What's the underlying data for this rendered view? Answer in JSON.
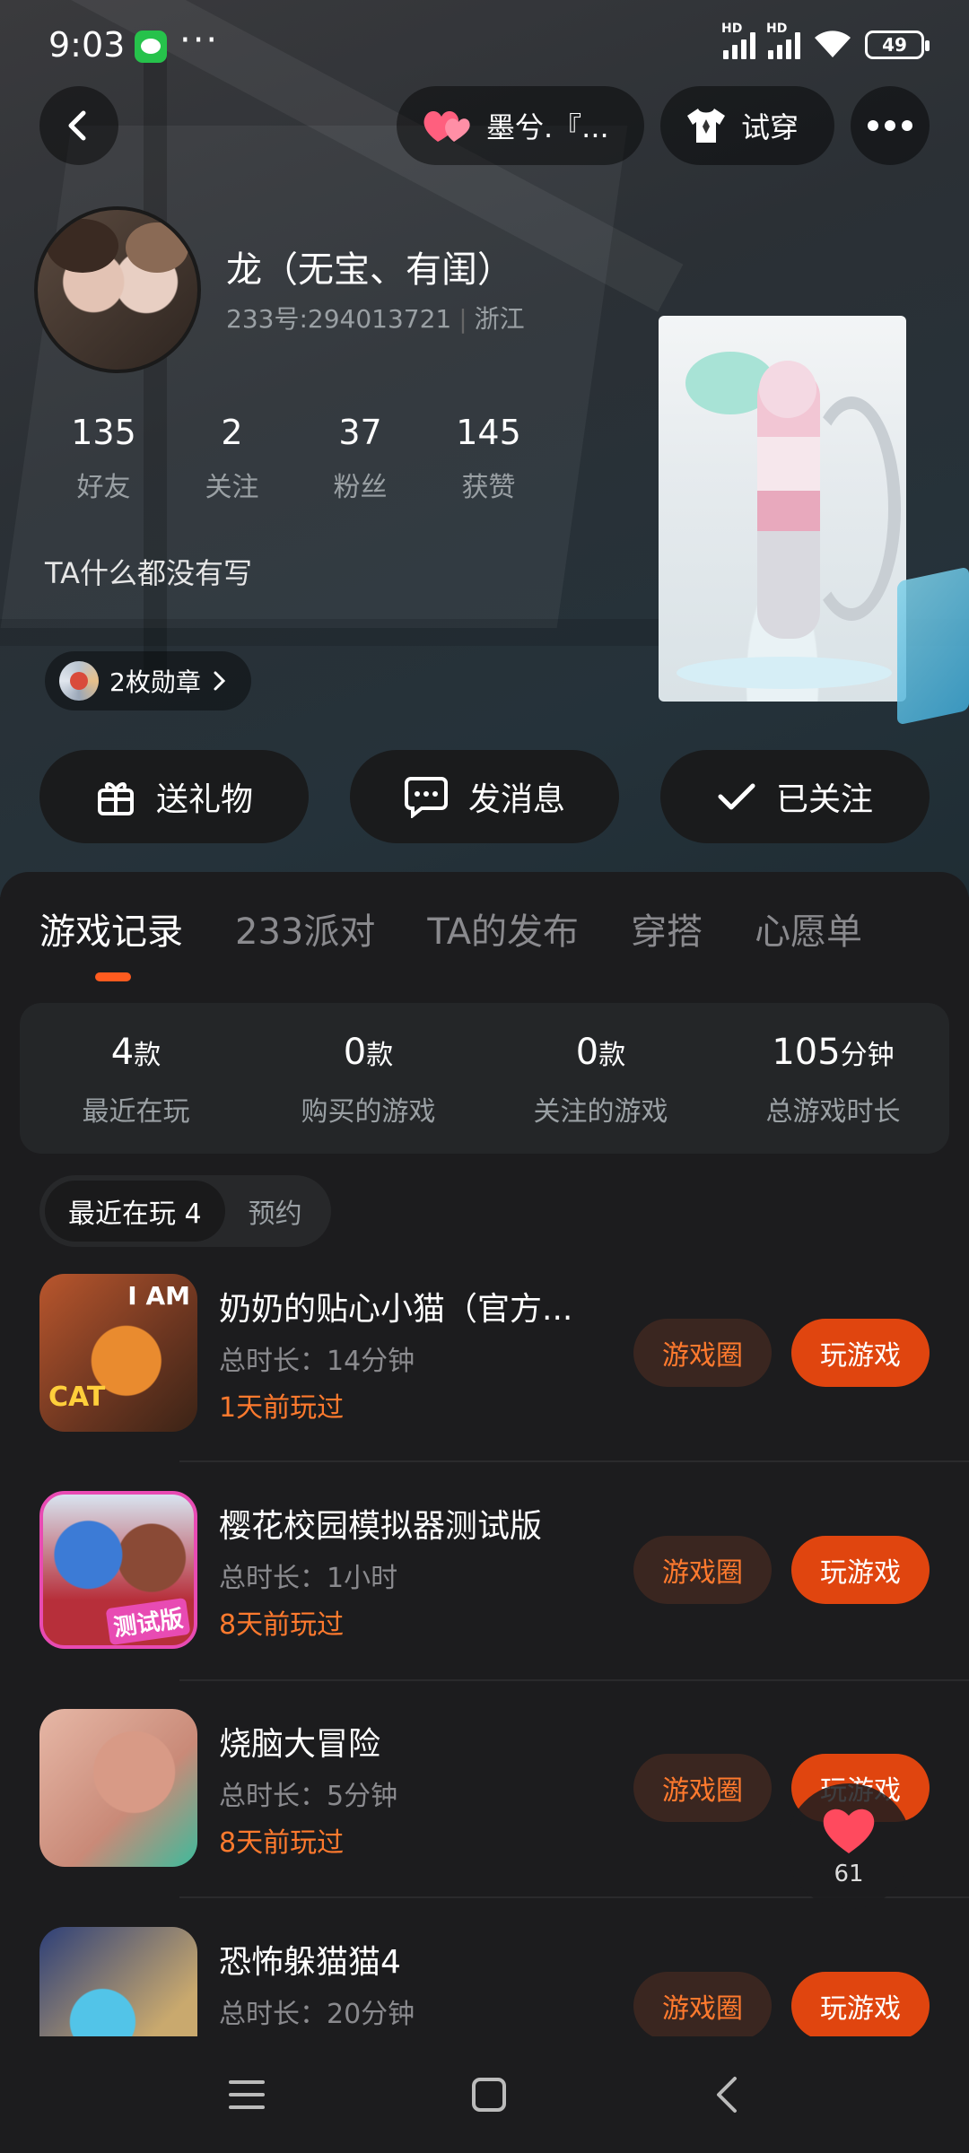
{
  "status_bar": {
    "time": "9:03",
    "dots": "···",
    "hd1": "HD",
    "hd2": "HD",
    "battery": "49"
  },
  "top_bar": {
    "couple_name": "墨兮.『...",
    "tryon_label": "试穿"
  },
  "profile": {
    "name": "龙（无宝、有闺）",
    "id_label": "233号:294013721",
    "separator": "|",
    "region": "浙江",
    "bio": "TA什么都没有写",
    "medal_label": "2枚勋章",
    "stats": [
      {
        "value": "135",
        "label": "好友"
      },
      {
        "value": "2",
        "label": "关注"
      },
      {
        "value": "37",
        "label": "粉丝"
      },
      {
        "value": "145",
        "label": "获赞"
      }
    ]
  },
  "actions": {
    "gift": "送礼物",
    "message": "发消息",
    "follow": "已关注"
  },
  "tabs": [
    "游戏记录",
    "233派对",
    "TA的发布",
    "穿搭",
    "心愿单"
  ],
  "summary": [
    {
      "value": "4",
      "unit": "款",
      "label": "最近在玩"
    },
    {
      "value": "0",
      "unit": "款",
      "label": "购买的游戏"
    },
    {
      "value": "0",
      "unit": "款",
      "label": "关注的游戏"
    },
    {
      "value": "105",
      "unit": "分钟",
      "label": "总游戏时长"
    }
  ],
  "subtabs": [
    "最近在玩 4",
    "预约"
  ],
  "games": [
    {
      "title": "奶奶的贴心小猫（官方...",
      "duration": "总时长：14分钟",
      "last_played": "1天前玩过",
      "icon_text": "CAT",
      "icon_text2": "I AM"
    },
    {
      "title": "樱花校园模拟器测试版",
      "duration": "总时长：1小时",
      "last_played": "8天前玩过",
      "icon_text": "测试版"
    },
    {
      "title": "烧脑大冒险",
      "duration": "总时长：5分钟",
      "last_played": "8天前玩过"
    },
    {
      "title": "恐怖躲猫猫4",
      "duration": "总时长：20分钟",
      "last_played": ""
    }
  ],
  "game_buttons": {
    "circle": "游戏圈",
    "play": "玩游戏"
  },
  "floating_like": {
    "count": "61"
  },
  "colors": {
    "accent": "#e0450f",
    "accent_text": "#ff7a2e",
    "background": "#1c1c1e"
  }
}
